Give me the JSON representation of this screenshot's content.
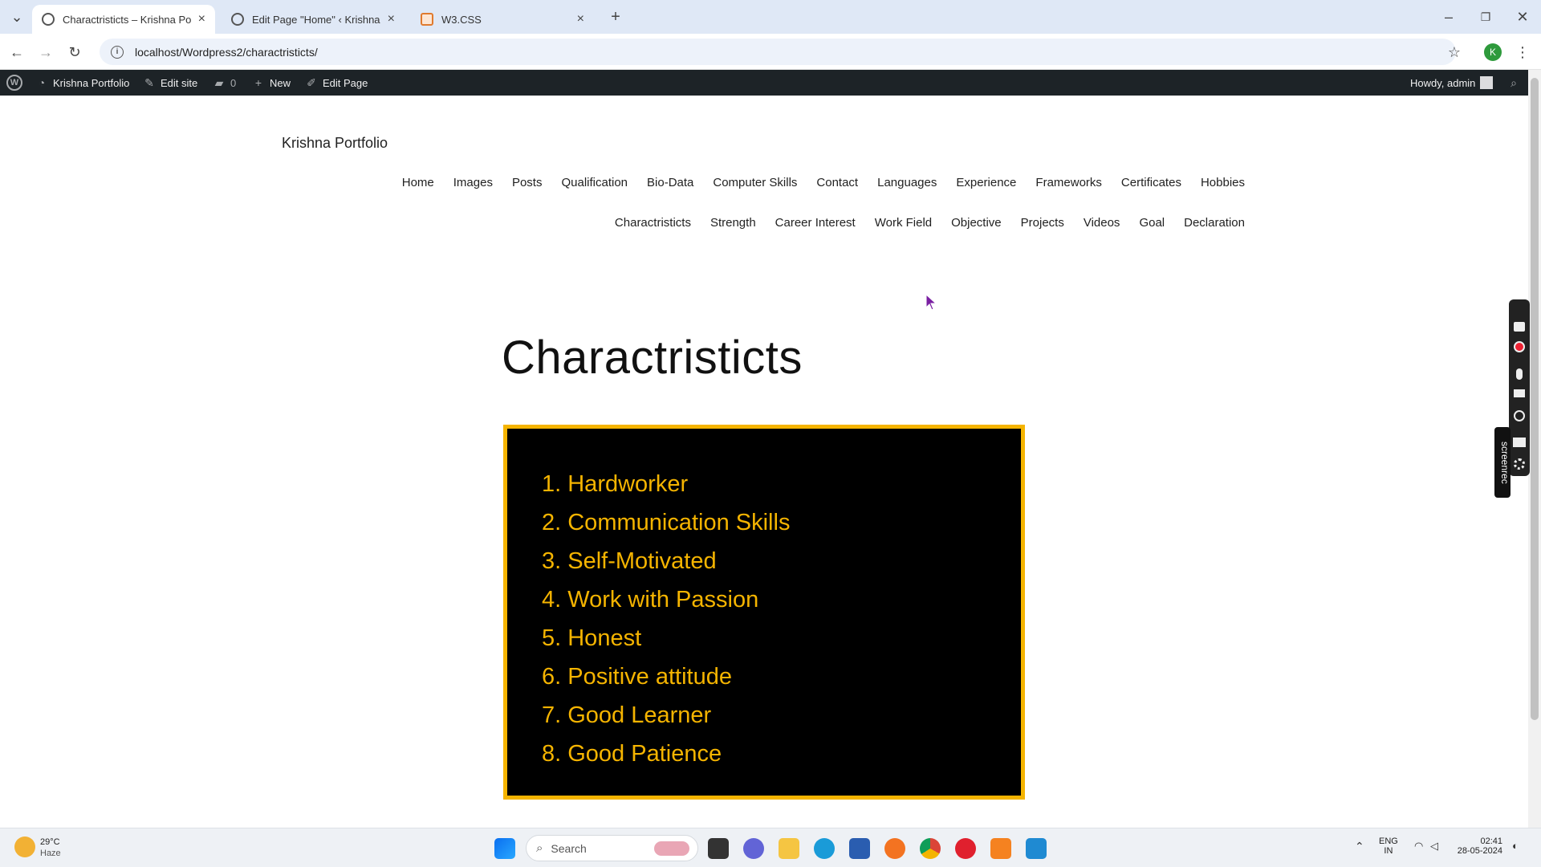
{
  "browser": {
    "tabs": [
      {
        "title": "Charactristicts – Krishna Portfol",
        "active": true
      },
      {
        "title": "Edit Page \"Home\" ‹ Krishna Por",
        "active": false
      },
      {
        "title": "W3.CSS",
        "active": false
      }
    ],
    "url": "localhost/Wordpress2/charactristicts/",
    "profile_initial": "K"
  },
  "adminbar": {
    "site_name": "Krishna Portfolio",
    "edit_site": "Edit site",
    "comments_count": "0",
    "new_label": "New",
    "edit_page": "Edit Page",
    "howdy": "Howdy, admin"
  },
  "site": {
    "title": "Krishna Portfolio",
    "nav_row1": [
      "Home",
      "Images",
      "Posts",
      "Qualification",
      "Bio-Data",
      "Computer Skills",
      "Contact",
      "Languages",
      "Experience",
      "Frameworks",
      "Certificates",
      "Hobbies"
    ],
    "nav_row2": [
      "Charactristicts",
      "Strength",
      "Career Interest",
      "Work Field",
      "Objective",
      "Projects",
      "Videos",
      "Goal",
      "Declaration"
    ]
  },
  "page": {
    "title": "Charactristicts",
    "items": [
      "1. Hardworker",
      "2. Communication Skills",
      "3. Self-Motivated",
      "4. Work with Passion",
      "5. Honest",
      "6. Positive attitude",
      "7. Good Learner",
      "8. Good Patience"
    ],
    "accent_color": "#f5b400"
  },
  "screenrec": {
    "label": "screenrec"
  },
  "taskbar": {
    "weather_temp": "29°C",
    "weather_desc": "Haze",
    "search_placeholder": "Search",
    "lang_top": "ENG",
    "lang_bottom": "IN",
    "time": "02:41",
    "date": "28-05-2024"
  }
}
